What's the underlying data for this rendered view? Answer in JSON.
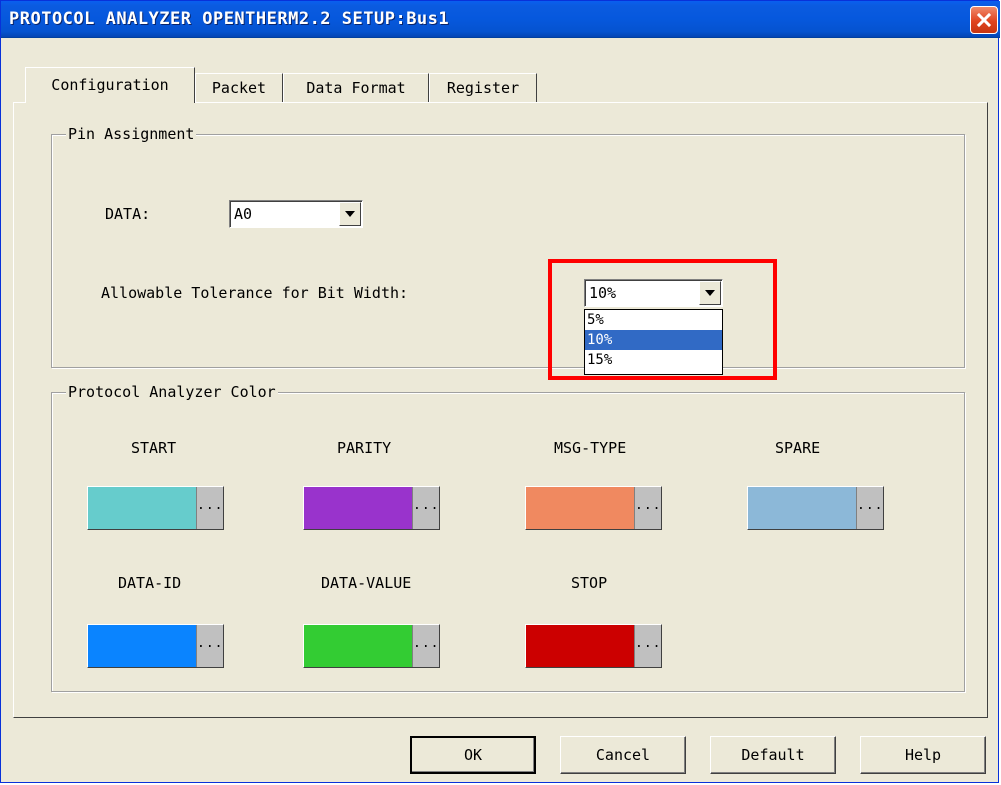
{
  "window": {
    "title": "PROTOCOL ANALYZER OPENTHERM2.2 SETUP:Bus1"
  },
  "tabs": [
    {
      "label": "Configuration",
      "active": true
    },
    {
      "label": "Packet",
      "active": false
    },
    {
      "label": "Data Format",
      "active": false
    },
    {
      "label": "Register",
      "active": false
    }
  ],
  "pin_assignment": {
    "title": "Pin Assignment",
    "data_label": "DATA:",
    "data_value": "A0",
    "tolerance_label": "Allowable Tolerance for Bit Width:",
    "tolerance_value": "10%",
    "tolerance_options": [
      "5%",
      "10%",
      "15%"
    ],
    "tolerance_selected": "10%"
  },
  "color_group": {
    "title": "Protocol Analyzer Color",
    "items": [
      {
        "label": "START",
        "color": "#66cccc"
      },
      {
        "label": "PARITY",
        "color": "#9933cc"
      },
      {
        "label": "MSG-TYPE",
        "color": "#f08960"
      },
      {
        "label": "SPARE",
        "color": "#8cb8d8"
      },
      {
        "label": "DATA-ID",
        "color": "#0a84ff"
      },
      {
        "label": "DATA-VALUE",
        "color": "#33cc33"
      },
      {
        "label": "STOP",
        "color": "#cc0000"
      }
    ],
    "picker_label": "..."
  },
  "buttons": {
    "ok": "OK",
    "cancel": "Cancel",
    "default": "Default",
    "help": "Help"
  },
  "annotation": {
    "highlight_color": "#ff0000"
  }
}
